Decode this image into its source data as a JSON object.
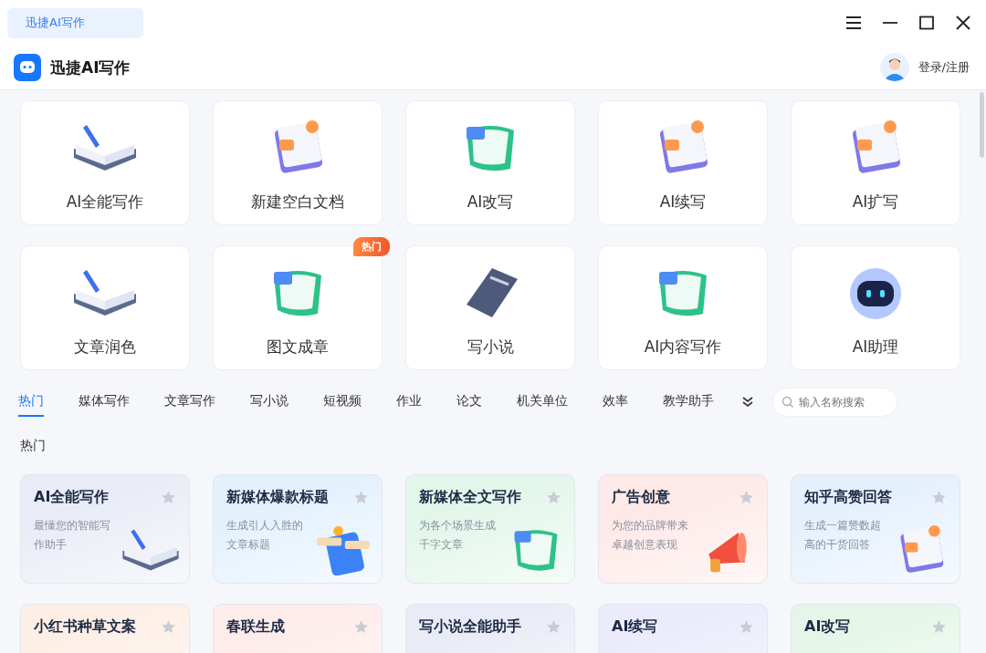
{
  "window": {
    "tab_title": "迅捷AI写作",
    "app_name": "迅捷AI写作",
    "account": "登录/注册"
  },
  "tools": [
    {
      "label": "AI全能写作",
      "kind": "book"
    },
    {
      "label": "新建空白文档",
      "kind": "document"
    },
    {
      "label": "AI改写",
      "kind": "scroll"
    },
    {
      "label": "AI续写",
      "kind": "document"
    },
    {
      "label": "AI扩写",
      "kind": "document"
    },
    {
      "label": "文章润色",
      "kind": "book"
    },
    {
      "label": "图文成章",
      "kind": "scroll",
      "badge": "热门"
    },
    {
      "label": "写小说",
      "kind": "notebook"
    },
    {
      "label": "AI内容写作",
      "kind": "scroll"
    },
    {
      "label": "AI助理",
      "kind": "robot"
    }
  ],
  "categories": [
    {
      "label": "热门",
      "selected": true
    },
    {
      "label": "媒体写作",
      "selected": false
    },
    {
      "label": "文章写作",
      "selected": false
    },
    {
      "label": "写小说",
      "selected": false
    },
    {
      "label": "短视频",
      "selected": false
    },
    {
      "label": "作业",
      "selected": false
    },
    {
      "label": "论文",
      "selected": false
    },
    {
      "label": "机关单位",
      "selected": false
    },
    {
      "label": "效率",
      "selected": false
    },
    {
      "label": "教学助手",
      "selected": false
    }
  ],
  "search": {
    "placeholder": "输入名称搜索"
  },
  "section_title": "热门",
  "templates": [
    {
      "title": "AI全能写作",
      "description": "最懂您的智能写作助手",
      "color": "#e9ecf6",
      "favorite": false,
      "kind": "book"
    },
    {
      "title": "新媒体爆款标题",
      "description": "生成引人入胜的文章标题",
      "color": "#e3f1fd",
      "favorite": false,
      "kind": "phone"
    },
    {
      "title": "新媒体全文写作",
      "description": "为各个场景生成千字文章",
      "color": "#e2f6ea",
      "favorite": false,
      "kind": "scroll"
    },
    {
      "title": "广告创意",
      "description": "为您的品牌带来卓越创意表现",
      "color": "#fde9e7",
      "favorite": false,
      "kind": "megaphone"
    },
    {
      "title": "知乎高赞回答",
      "description": "生成一篇赞数超高的干货回答",
      "color": "#e5f0fd",
      "favorite": false,
      "kind": "document"
    },
    {
      "title": "小红书种草文案",
      "color": "#fdefe6",
      "favorite": false,
      "kind": "none"
    },
    {
      "title": "春联生成",
      "color": "#fdecea",
      "favorite": false,
      "kind": "none"
    },
    {
      "title": "写小说全能助手",
      "color": "#e9ecf6",
      "favorite": false,
      "kind": "none"
    },
    {
      "title": "AI续写",
      "color": "#ebebfb",
      "favorite": false,
      "kind": "none"
    },
    {
      "title": "AI改写",
      "color": "#e5f6e9",
      "favorite": false,
      "kind": "none"
    }
  ]
}
